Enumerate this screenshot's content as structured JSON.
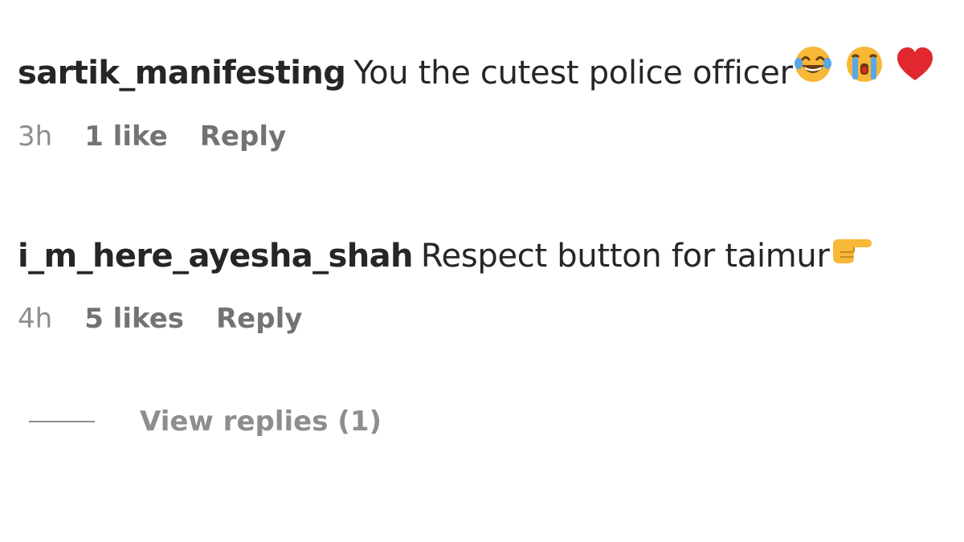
{
  "comments": [
    {
      "username": "sartik_manifesting",
      "text": "You the cutest police officer",
      "emojis": [
        "laughing-tears-emoji",
        "crying-emoji",
        "red-heart-emoji"
      ],
      "time": "3h",
      "likes": "1 like",
      "reply_label": "Reply"
    },
    {
      "username": "i_m_here_ayesha_shah",
      "text": "Respect button for taimur",
      "emojis": [
        "pointing-right-emoji"
      ],
      "time": "4h",
      "likes": "5 likes",
      "reply_label": "Reply"
    }
  ],
  "view_replies": {
    "label": "View replies (1)"
  },
  "colors": {
    "text": "#262626",
    "secondary": "#8e8e8e",
    "emoji_face": "#f7b737",
    "heart": "#e0282e"
  }
}
